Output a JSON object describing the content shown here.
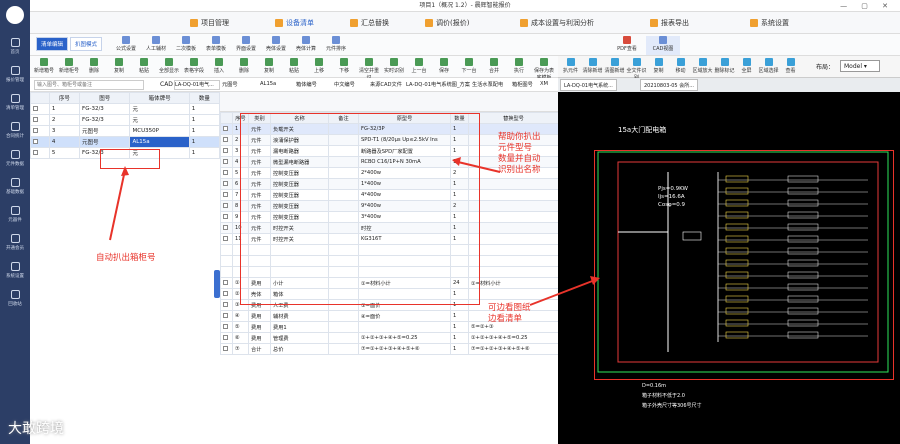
{
  "window": {
    "title": "项目1（概况 1.2）- 晨辉智能报价"
  },
  "sidebar": {
    "items": [
      "首页",
      "报价管理",
      "清单管理",
      "合同统计",
      "元件数据",
      "基础数据",
      "元器件",
      "开通会员",
      "系统设置",
      "回收站"
    ]
  },
  "menu": {
    "items": [
      "项目管理",
      "设备清单",
      "汇总替换",
      "调价(报价)",
      "成本设置与利润分析",
      "报表导出",
      "系统设置"
    ]
  },
  "ribbon": {
    "tabs": [
      "清单编辑",
      "扒图模式"
    ],
    "tools": [
      "公式设置",
      "人工辅材",
      "二次模板",
      "表单模板",
      "界面设置",
      "壳体设置",
      "壳体计算",
      "元件排序"
    ],
    "right_tools": [
      "PDF查看",
      "CAD视图"
    ]
  },
  "ribbon2": {
    "tools": [
      "新增箱号",
      "新增柜号",
      "删除",
      "复制",
      "粘贴",
      "全部显示",
      "表格字段",
      "插入",
      "删除",
      "复制",
      "粘贴",
      "上移",
      "下移",
      "清空并重识",
      "实时识别",
      "上一台",
      "保存",
      "下一台",
      "合并",
      "执行",
      "保存为表底模板"
    ]
  },
  "cad": {
    "tools": [
      "扒元件",
      "清除新增",
      "清图新增",
      "全文件识别",
      "复制",
      "移动",
      "区域放大",
      "删除标记",
      "全屏",
      "区域选择",
      "查看"
    ],
    "layout_label": "布局：",
    "layout_value": "Model",
    "tabs": [
      "LA-DQ-01电气系统...",
      "20210803-05 会所..."
    ],
    "drawing_title": "15a大门配电箱",
    "params": [
      "Pjs=0.9KW",
      "Ijs=16.6A",
      "Cosφ=0.9"
    ],
    "bottom_notes": [
      "D=0.16m",
      "箱子材料不低于2.0",
      "箱子外壳尺寸等306号尺寸"
    ]
  },
  "left": {
    "search_placeholder": "输入图号、箱柜号或备注",
    "cad_label": "CAD",
    "cad_value": "LA-DQ-01电气...",
    "columns": [
      "",
      "序号",
      "图号",
      "箱体牌号",
      "数量"
    ],
    "rows": [
      {
        "no": "1",
        "drawing": "FG-32/3",
        "box": "元",
        "qty": "1"
      },
      {
        "no": "2",
        "drawing": "FG-32/3",
        "box": "元",
        "qty": "1"
      },
      {
        "no": "3",
        "drawing": "元图号",
        "box": "MCU350P",
        "qty": "1"
      },
      {
        "no": "4",
        "drawing": "元图号",
        "box": "AL15a",
        "qty": "1"
      },
      {
        "no": "5",
        "drawing": "FG-32/3",
        "box": "元",
        "qty": "1"
      }
    ]
  },
  "mid": {
    "header": [
      "元图号",
      "AL15a",
      "箱体编号",
      "中文编号",
      "来源CAD文件",
      "LA-DQ-01电气系统图_方案...",
      "生活水泵配电",
      "箱柜图号",
      "XM"
    ],
    "columns": [
      "",
      "序号",
      "类别",
      "名称",
      "备注",
      "原型号",
      "数量",
      "替换型号"
    ],
    "rows": [
      {
        "no": "1",
        "cat": "元件",
        "name": "负载开关",
        "note": "",
        "model": "FG-32/3P",
        "qty": "1"
      },
      {
        "no": "2",
        "cat": "元件",
        "name": "浪涌保护器",
        "note": "",
        "model": "SPD-T1 (8/20μs Up≤2.5kV Ins",
        "qty": "1"
      },
      {
        "no": "3",
        "cat": "元件",
        "name": "漏电断路器",
        "note": "",
        "model": "断路器及SPD厂家配置",
        "qty": "1"
      },
      {
        "no": "4",
        "cat": "元件",
        "name": "微型漏电断路器",
        "note": "",
        "model": "RCBO C16/1P+N 30mA",
        "qty": "11"
      },
      {
        "no": "5",
        "cat": "元件",
        "name": "控制变压器",
        "note": "",
        "model": "2*400w",
        "qty": "2"
      },
      {
        "no": "6",
        "cat": "元件",
        "name": "控制变压器",
        "note": "",
        "model": "1*400w",
        "qty": "1"
      },
      {
        "no": "7",
        "cat": "元件",
        "name": "控制变压器",
        "note": "",
        "model": "4*400w",
        "qty": "1"
      },
      {
        "no": "8",
        "cat": "元件",
        "name": "控制变压器",
        "note": "",
        "model": "9*400w",
        "qty": "2"
      },
      {
        "no": "9",
        "cat": "元件",
        "name": "控制变压器",
        "note": "",
        "model": "3*400w",
        "qty": "1"
      },
      {
        "no": "10",
        "cat": "元件",
        "name": "时控开关",
        "note": "",
        "model": "时控",
        "qty": "1"
      },
      {
        "no": "11",
        "cat": "元件",
        "name": "时控开关",
        "note": "",
        "model": "KG316T",
        "qty": "1"
      }
    ],
    "cost_rows": [
      {
        "no": "①",
        "cat": "费用",
        "name": "小计",
        "model": "①=材料小计",
        "qty": "24",
        "alt": "①=材料小计"
      },
      {
        "no": "②",
        "cat": "壳体",
        "name": "箱体",
        "model": "",
        "qty": "1",
        "alt": ""
      },
      {
        "no": "③",
        "cat": "费用",
        "name": "人工费",
        "model": "③=面价",
        "qty": "1",
        "alt": ""
      },
      {
        "no": "④",
        "cat": "费用",
        "name": "辅材费",
        "model": "④=面价",
        "qty": "1",
        "alt": ""
      },
      {
        "no": "⑤",
        "cat": "费用",
        "name": "费用1",
        "model": "",
        "qty": "1",
        "alt": "⑤=②+③"
      },
      {
        "no": "⑥",
        "cat": "费用",
        "name": "管理费",
        "model": "①+②+③+④+⑤=0.25",
        "qty": "1",
        "alt": "①+②+③+④+⑤=0.25"
      },
      {
        "no": "⑦",
        "cat": "合计",
        "name": "总价",
        "model": "⑦=①+②+③+④+⑤+⑥",
        "qty": "1",
        "alt": "⑦=①+②+③+④+⑤+⑥"
      }
    ]
  },
  "annotations": {
    "left": "自动扒出箱柜号",
    "right_top": [
      "帮助你扒出",
      "元件型号",
      "数量并自动",
      "识别出名称"
    ],
    "right_bottom": [
      "可边看图纸",
      "边看清单"
    ]
  },
  "watermark": "大敢跨境",
  "colors": {
    "accent": "#2a62c9",
    "annotation": "#e8332a",
    "sidebar": "#2c3e66"
  }
}
